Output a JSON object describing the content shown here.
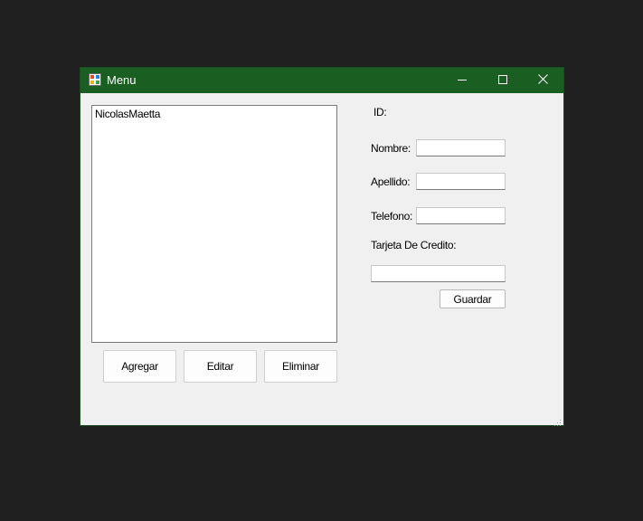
{
  "window": {
    "title": "Menu",
    "icon": "app-form-icon",
    "controls": [
      "minimize-icon",
      "maximize-icon",
      "close-icon"
    ],
    "titlebar_color": "#1b5e22"
  },
  "list": {
    "items": [
      "NicolasMaetta"
    ]
  },
  "buttons": {
    "agregar": "Agregar",
    "editar": "Editar",
    "eliminar": "Eliminar",
    "guardar": "Guardar"
  },
  "form": {
    "id_label": "ID:",
    "nombre_label": "Nombre:",
    "nombre_value": "",
    "apellido_label": "Apellido:",
    "apellido_value": "",
    "telefono_label": "Telefono:",
    "telefono_value": "",
    "tarjeta_label": "Tarjeta De Credito:",
    "tarjeta_value": ""
  }
}
